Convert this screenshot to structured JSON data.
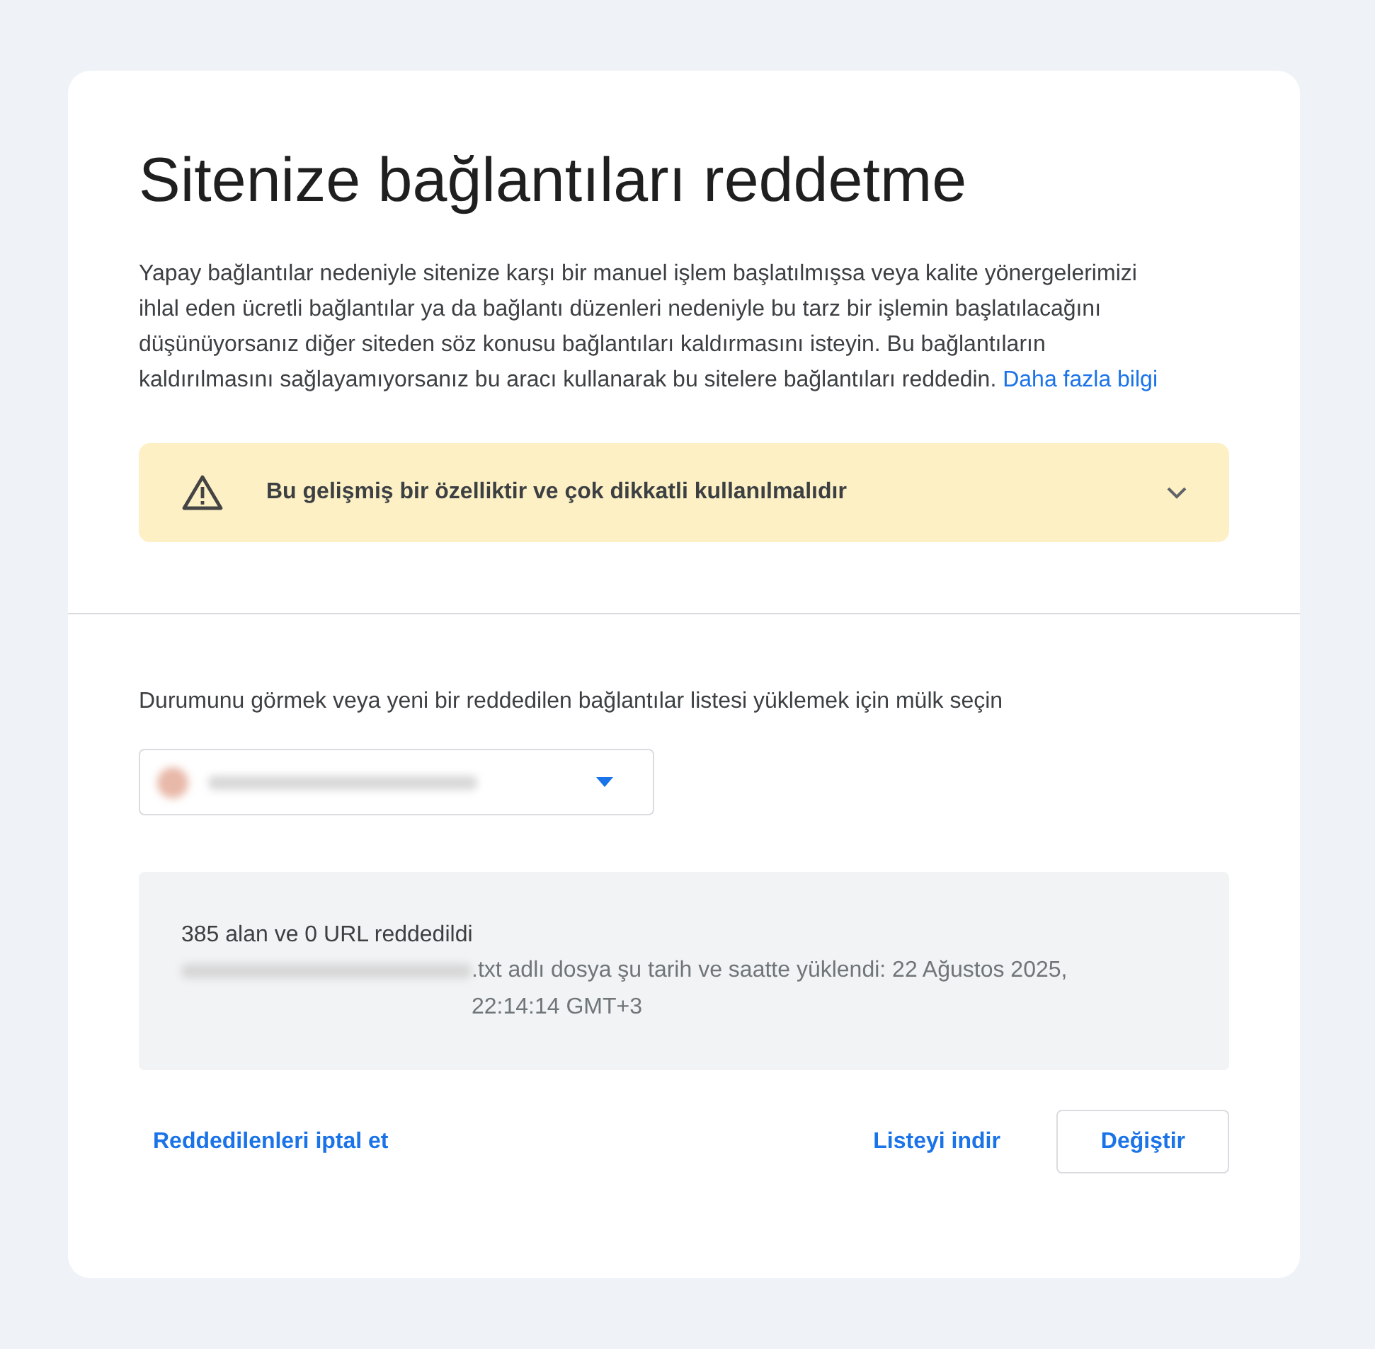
{
  "title": "Sitenize bağlantıları reddetme",
  "intro": {
    "text": "Yapay bağlantılar nedeniyle sitenize karşı bir manuel işlem başlatılmışsa veya kalite yönergelerimizi ihlal eden ücretli bağlantılar ya da bağlantı düzenleri nedeniyle bu tarz bir işlemin başlatılacağını düşünüyorsanız diğer siteden söz konusu bağlantıları kaldırmasını isteyin. Bu bağlantıların kaldırılmasını sağlayamıyorsanız bu aracı kullanarak bu sitelere bağlantıları reddedin.",
    "link": "Daha fazla bilgi"
  },
  "warning": {
    "text": "Bu gelişmiş bir özelliktir ve çok dikkatli kullanılmalıdır",
    "expanded": false
  },
  "property_prompt": "Durumunu görmek veya yeni bir reddedilen bağlantılar listesi yüklemek için mülk seçin",
  "status": {
    "heading": "385 alan ve 0 URL reddedildi",
    "detail": ".txt adlı dosya şu tarih ve saatte yüklendi: 22 Ağustos 2025, 22:14:14 GMT+3"
  },
  "buttons": [
    {
      "label": "Reddedilenleri iptal et",
      "kind": "text"
    },
    {
      "label": "Listeyi indir",
      "kind": "text"
    },
    {
      "label": "Değiştir",
      "kind": "outlined"
    }
  ]
}
